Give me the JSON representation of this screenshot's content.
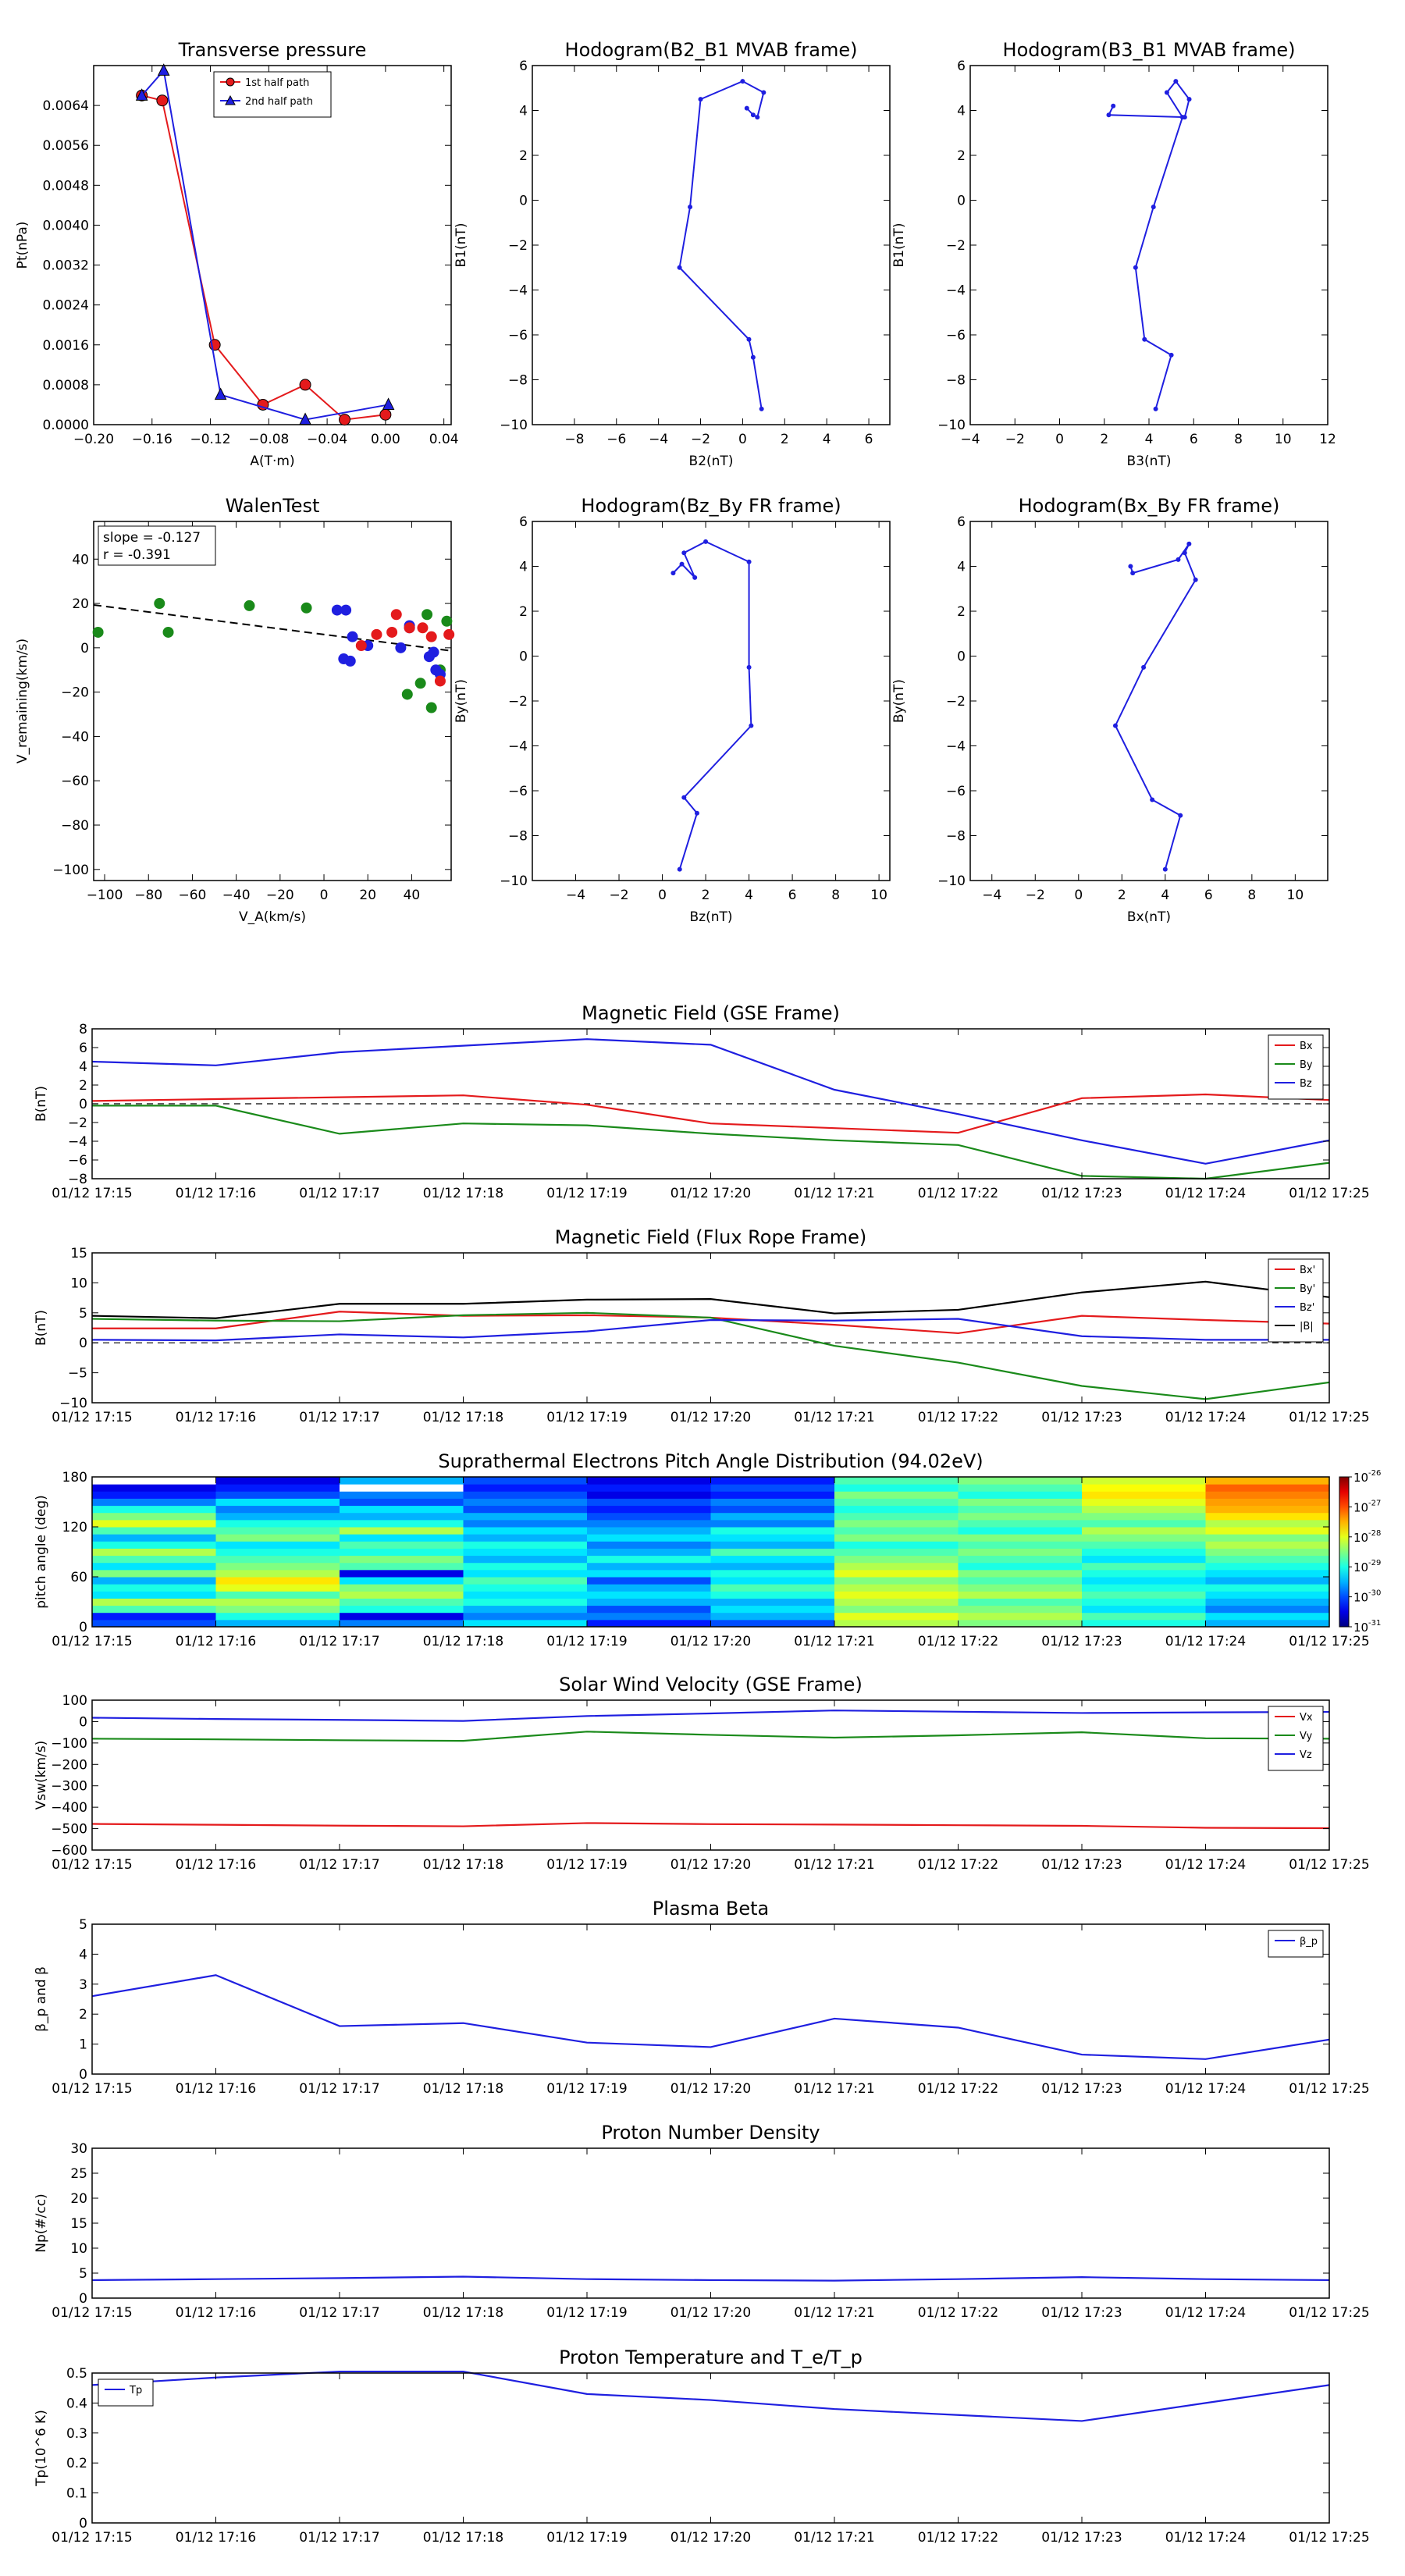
{
  "time_ticks": [
    "01/12 17:15",
    "01/12 17:16",
    "01/12 17:17",
    "01/12 17:18",
    "01/12 17:19",
    "01/12 17:20",
    "01/12 17:21",
    "01/12 17:22",
    "01/12 17:23",
    "01/12 17:24",
    "01/12 17:25"
  ],
  "colors": {
    "red": "#e41a1c",
    "green": "#1a8a1a",
    "blue": "#1f1fe0",
    "black": "#000000"
  },
  "chart_data": [
    {
      "id": "tp",
      "type": "line",
      "title": "Transverse pressure",
      "xlabel": "A(T·m)",
      "ylabel": "Pt(nPa)",
      "xlim": [
        -0.2,
        0.045
      ],
      "ylim": [
        0,
        0.0072
      ],
      "xticks": [
        -0.2,
        -0.16,
        -0.12,
        -0.08,
        -0.04,
        0.0,
        0.04
      ],
      "xtick_labels": [
        "−0.20",
        "−0.16",
        "−0.12",
        "−0.08",
        "−0.04",
        "0.00",
        "0.04"
      ],
      "yticks": [
        0,
        0.0008,
        0.0016,
        0.0024,
        0.0032,
        0.004,
        0.0048,
        0.0056,
        0.0064
      ],
      "ytick_labels": [
        "0.0000",
        "0.0008",
        "0.0016",
        "0.0024",
        "0.0032",
        "0.0040",
        "0.0048",
        "0.0056",
        "0.0064"
      ],
      "legend": {
        "loc": "top-center",
        "entries": [
          "1st half path",
          "2nd half path"
        ]
      },
      "series": [
        {
          "name": "1st half path",
          "color": "red",
          "marker": "circle",
          "x": [
            -0.167,
            -0.153,
            -0.117,
            -0.084,
            -0.055,
            -0.028,
            0.0
          ],
          "y": [
            0.0066,
            0.0065,
            0.0016,
            0.0004,
            0.0008,
            0.0001,
            0.0002
          ]
        },
        {
          "name": "2nd half path",
          "color": "blue",
          "marker": "triangle",
          "x": [
            -0.167,
            -0.152,
            -0.113,
            -0.055,
            0.002
          ],
          "y": [
            0.0066,
            0.0071,
            0.0006,
            0.0001,
            0.0004
          ]
        }
      ]
    },
    {
      "id": "h1",
      "type": "line",
      "title": "Hodogram(B2_B1 MVAB frame)",
      "xlabel": "B2(nT)",
      "ylabel": "B1(nT)",
      "xlim": [
        -10,
        7
      ],
      "ylim": [
        -10,
        6
      ],
      "xticks": [
        -8,
        -6,
        -4,
        -2,
        0,
        2,
        4,
        6
      ],
      "yticks": [
        -10,
        -8,
        -6,
        -4,
        -2,
        0,
        2,
        4,
        6
      ],
      "series": [
        {
          "color": "blue",
          "x": [
            0.9,
            0.5,
            0.3,
            -3.0,
            -2.5,
            -2.0,
            0.0,
            1.0,
            0.7,
            0.5,
            0.2
          ],
          "y": [
            -9.3,
            -7.0,
            -6.2,
            -3.0,
            -0.3,
            4.5,
            5.3,
            4.8,
            3.7,
            3.8,
            4.1
          ]
        }
      ]
    },
    {
      "id": "h2",
      "type": "line",
      "title": "Hodogram(B3_B1 MVAB frame)",
      "xlabel": "B3(nT)",
      "ylabel": "B1(nT)",
      "xlim": [
        -4,
        12
      ],
      "ylim": [
        -10,
        6
      ],
      "xticks": [
        -4,
        -2,
        0,
        2,
        4,
        6,
        8,
        10,
        12
      ],
      "yticks": [
        -10,
        -8,
        -6,
        -4,
        -2,
        0,
        2,
        4,
        6
      ],
      "series": [
        {
          "color": "blue",
          "x": [
            4.3,
            5.0,
            3.8,
            3.4,
            4.2,
            5.5,
            4.8,
            5.2,
            5.8,
            5.6,
            2.2,
            2.4
          ],
          "y": [
            -9.3,
            -6.9,
            -6.2,
            -3.0,
            -0.3,
            3.7,
            4.8,
            5.3,
            4.5,
            3.7,
            3.8,
            4.2
          ]
        }
      ]
    },
    {
      "id": "walen",
      "type": "scatter",
      "title": "WalenTest",
      "xlabel": "V_A(km/s)",
      "ylabel": "V_remaining(km/s)",
      "xlim": [
        -105,
        58
      ],
      "ylim": [
        -105,
        57
      ],
      "xticks": [
        -100,
        -80,
        -60,
        -40,
        -20,
        0,
        20,
        40
      ],
      "yticks": [
        -100,
        -80,
        -60,
        -40,
        -20,
        0,
        20,
        40
      ],
      "annotations": [
        "slope = -0.127",
        "r = -0.391"
      ],
      "fit": {
        "slope": -0.127,
        "intercept": 6
      },
      "series": [
        {
          "color": "green",
          "x": [
            -103,
            -75,
            -71,
            -34,
            -8,
            38,
            44,
            47,
            49,
            56,
            53
          ],
          "y": [
            7,
            20,
            7,
            19,
            18,
            -21,
            -16,
            15,
            -27,
            12,
            -10
          ]
        },
        {
          "color": "blue",
          "x": [
            6,
            10,
            13,
            20,
            35,
            39,
            39,
            48,
            50,
            51,
            53,
            9,
            12
          ],
          "y": [
            17,
            17,
            5,
            1,
            0,
            9,
            10,
            -4,
            -2,
            -10,
            -12,
            -5,
            -6
          ]
        },
        {
          "color": "red",
          "x": [
            17,
            24,
            31,
            33,
            39,
            45,
            49,
            53,
            57
          ],
          "y": [
            1,
            6,
            7,
            15,
            9,
            9,
            5,
            -15,
            6
          ]
        }
      ]
    },
    {
      "id": "h3",
      "type": "line",
      "title": "Hodogram(Bz_By FR frame)",
      "xlabel": "Bz(nT)",
      "ylabel": "By(nT)",
      "xlim": [
        -6,
        10.5
      ],
      "ylim": [
        -10,
        6
      ],
      "xticks": [
        -4,
        -2,
        0,
        2,
        4,
        6,
        8,
        10
      ],
      "yticks": [
        -10,
        -8,
        -6,
        -4,
        -2,
        0,
        2,
        4,
        6
      ],
      "series": [
        {
          "color": "blue",
          "x": [
            0.8,
            1.6,
            1.0,
            4.1,
            4.0,
            4.0,
            2.0,
            1.0,
            1.5,
            0.9,
            0.5
          ],
          "y": [
            -9.5,
            -7.0,
            -6.3,
            -3.1,
            -0.5,
            4.2,
            5.1,
            4.6,
            3.5,
            4.1,
            3.7
          ]
        }
      ]
    },
    {
      "id": "h4",
      "type": "line",
      "title": "Hodogram(Bx_By FR frame)",
      "xlabel": "Bx(nT)",
      "ylabel": "By(nT)",
      "xlim": [
        -5,
        11.5
      ],
      "ylim": [
        -10,
        6
      ],
      "xticks": [
        -4,
        -2,
        0,
        2,
        4,
        6,
        8,
        10
      ],
      "yticks": [
        -10,
        -8,
        -6,
        -4,
        -2,
        0,
        2,
        4,
        6
      ],
      "series": [
        {
          "color": "blue",
          "x": [
            4.0,
            4.7,
            3.4,
            1.7,
            3.0,
            5.4,
            4.9,
            5.1,
            4.6,
            2.5,
            2.4
          ],
          "y": [
            -9.5,
            -7.1,
            -6.4,
            -3.1,
            -0.5,
            3.4,
            4.6,
            5.0,
            4.3,
            3.7,
            4.0
          ]
        }
      ]
    },
    {
      "id": "mag_gse",
      "type": "line",
      "title": "Magnetic Field (GSE Frame)",
      "ylabel": "B(nT)",
      "xticks": "time",
      "ylim": [
        -8,
        8
      ],
      "yticks": [
        -8,
        -6,
        -4,
        -2,
        0,
        2,
        4,
        6,
        8
      ],
      "legend": {
        "loc": "top-right",
        "entries": [
          "Bx",
          "By",
          "Bz"
        ]
      },
      "zero_line": true,
      "x": [
        0,
        1,
        2,
        3,
        4,
        5,
        6,
        7,
        8,
        9,
        10
      ],
      "series": [
        {
          "name": "Bx",
          "color": "red",
          "values": [
            0.3,
            0.5,
            0.7,
            0.9,
            -0.1,
            -2.1,
            -2.6,
            -3.1,
            0.6,
            1.0,
            0.4
          ]
        },
        {
          "name": "By",
          "color": "green",
          "values": [
            -0.2,
            -0.2,
            -3.2,
            -2.1,
            -2.3,
            -3.2,
            -3.9,
            -4.4,
            -7.7,
            -8.0,
            -6.3
          ]
        },
        {
          "name": "Bz",
          "color": "blue",
          "values": [
            4.5,
            4.1,
            5.5,
            6.2,
            6.9,
            6.3,
            1.5,
            -1.1,
            -3.9,
            -6.4,
            -3.9
          ]
        }
      ]
    },
    {
      "id": "mag_fr",
      "type": "line",
      "title": "Magnetic Field (Flux Rope Frame)",
      "ylabel": "B(nT)",
      "xticks": "time",
      "ylim": [
        -10,
        15
      ],
      "yticks": [
        -10,
        -5,
        0,
        5,
        10,
        15
      ],
      "legend": {
        "loc": "top-right",
        "entries": [
          "Bx'",
          "By'",
          "Bz'",
          "|B|"
        ]
      },
      "zero_line": true,
      "x": [
        0,
        1,
        2,
        3,
        4,
        5,
        6,
        7,
        8,
        9,
        10
      ],
      "series": [
        {
          "name": "Bx'",
          "color": "red",
          "values": [
            2.4,
            2.4,
            5.2,
            4.5,
            4.6,
            4.2,
            3.0,
            1.6,
            4.5,
            3.8,
            3.2
          ]
        },
        {
          "name": "By'",
          "color": "green",
          "values": [
            4.0,
            3.7,
            3.6,
            4.6,
            5.0,
            4.2,
            -0.5,
            -3.3,
            -7.2,
            -9.4,
            -6.6
          ]
        },
        {
          "name": "Bz'",
          "color": "blue",
          "values": [
            0.5,
            0.4,
            1.4,
            0.9,
            1.9,
            3.8,
            3.7,
            4.0,
            1.1,
            0.5,
            0.5
          ]
        },
        {
          "name": "|B|",
          "color": "black",
          "values": [
            4.5,
            4.1,
            6.5,
            6.5,
            7.2,
            7.3,
            4.9,
            5.5,
            8.4,
            10.2,
            7.6
          ]
        }
      ]
    },
    {
      "id": "pad",
      "type": "heatmap",
      "title": "Suprathermal Electrons Pitch Angle Distribution (94.02eV)",
      "ylabel": "pitch angle (deg)",
      "xticks": "time",
      "ylim": [
        0,
        180
      ],
      "yticks": [
        0,
        60,
        120,
        180
      ],
      "colorbar": {
        "log_min": -31,
        "log_max": -26,
        "ticks": [
          -31,
          -30,
          -29,
          -28,
          -27,
          -26
        ],
        "tick_labels": [
          "10",
          "10",
          "10",
          "10",
          "10",
          "10"
        ],
        "tick_exponents": [
          "-31",
          "-30",
          "-29",
          "-28",
          "-27",
          "-26"
        ]
      },
      "columns": [
        [
          0.2,
          0.15,
          0.45,
          0.55,
          0.35,
          0.4,
          0.3,
          0.5,
          0.35,
          0.45,
          0.55,
          0.4,
          0.3,
          0.45,
          0.6,
          0.5,
          0.4,
          0.25,
          0.15,
          0.1,
          1.0
        ],
        [
          0.3,
          0.4,
          0.5,
          0.55,
          0.45,
          0.6,
          0.65,
          0.55,
          0.5,
          0.45,
          0.4,
          0.35,
          0.5,
          0.45,
          0.4,
          0.3,
          0.25,
          0.35,
          0.2,
          0.15,
          0.1
        ],
        [
          0.25,
          0.1,
          0.4,
          0.45,
          0.55,
          0.5,
          0.35,
          0.1,
          0.45,
          0.5,
          0.4,
          0.45,
          0.35,
          0.55,
          0.4,
          0.3,
          0.35,
          0.2,
          0.25,
          1.0,
          0.3
        ],
        [
          0.35,
          0.25,
          0.3,
          0.4,
          0.35,
          0.4,
          0.45,
          0.35,
          0.4,
          0.3,
          0.35,
          0.4,
          0.3,
          0.35,
          0.25,
          0.3,
          0.2,
          0.25,
          0.2,
          0.15,
          0.2
        ],
        [
          0.15,
          0.25,
          0.2,
          0.3,
          0.35,
          0.3,
          0.2,
          0.35,
          0.3,
          0.4,
          0.3,
          0.25,
          0.35,
          0.3,
          0.25,
          0.2,
          0.15,
          0.2,
          0.1,
          0.15,
          0.1
        ],
        [
          0.2,
          0.3,
          0.35,
          0.3,
          0.4,
          0.45,
          0.35,
          0.4,
          0.3,
          0.35,
          0.45,
          0.3,
          0.35,
          0.4,
          0.25,
          0.3,
          0.2,
          0.25,
          0.15,
          0.2,
          0.15
        ],
        [
          0.55,
          0.6,
          0.5,
          0.55,
          0.6,
          0.55,
          0.5,
          0.6,
          0.55,
          0.5,
          0.45,
          0.4,
          0.5,
          0.45,
          0.5,
          0.45,
          0.4,
          0.45,
          0.5,
          0.4,
          0.45
        ],
        [
          0.5,
          0.55,
          0.5,
          0.45,
          0.55,
          0.5,
          0.45,
          0.5,
          0.4,
          0.45,
          0.5,
          0.45,
          0.5,
          0.4,
          0.45,
          0.5,
          0.45,
          0.5,
          0.4,
          0.45,
          0.5
        ],
        [
          0.4,
          0.45,
          0.35,
          0.4,
          0.45,
          0.4,
          0.35,
          0.4,
          0.45,
          0.35,
          0.4,
          0.45,
          0.5,
          0.55,
          0.45,
          0.5,
          0.55,
          0.6,
          0.65,
          0.62,
          0.58
        ],
        [
          0.3,
          0.35,
          0.25,
          0.3,
          0.35,
          0.4,
          0.3,
          0.35,
          0.4,
          0.45,
          0.5,
          0.55,
          0.5,
          0.6,
          0.55,
          0.65,
          0.7,
          0.72,
          0.75,
          0.78,
          0.7
        ]
      ]
    },
    {
      "id": "vsw",
      "type": "line",
      "title": "Solar Wind Velocity (GSE Frame)",
      "ylabel": "Vsw(km/s)",
      "xticks": "time",
      "ylim": [
        -600,
        100
      ],
      "yticks": [
        -600,
        -500,
        -400,
        -300,
        -200,
        -100,
        0,
        100
      ],
      "legend": {
        "loc": "top-right",
        "entries": [
          "Vx",
          "Vy",
          "Vz"
        ]
      },
      "x": [
        0,
        1,
        2,
        3,
        4,
        5,
        6,
        7,
        8,
        9,
        10
      ],
      "series": [
        {
          "name": "Vx",
          "color": "red",
          "values": [
            -478,
            -482,
            -486,
            -489,
            -474,
            -479,
            -481,
            -484,
            -487,
            -496,
            -498
          ]
        },
        {
          "name": "Vy",
          "color": "green",
          "values": [
            -80,
            -83,
            -87,
            -90,
            -47,
            -62,
            -75,
            -64,
            -50,
            -78,
            -80
          ]
        },
        {
          "name": "Vz",
          "color": "blue",
          "values": [
            18,
            12,
            8,
            3,
            26,
            38,
            52,
            46,
            40,
            43,
            45
          ]
        }
      ]
    },
    {
      "id": "beta",
      "type": "line",
      "title": "Plasma Beta",
      "ylabel": "β_p and β",
      "xticks": "time",
      "ylim": [
        0,
        5
      ],
      "yticks": [
        0,
        1,
        2,
        3,
        4,
        5
      ],
      "legend": {
        "loc": "top-right",
        "entries": [
          "β_p"
        ]
      },
      "x": [
        0,
        1,
        2,
        3,
        4,
        5,
        6,
        7,
        8,
        9,
        10
      ],
      "series": [
        {
          "name": "β_p",
          "color": "blue",
          "values": [
            2.6,
            3.3,
            1.6,
            1.7,
            1.05,
            0.9,
            1.85,
            1.55,
            0.65,
            0.5,
            1.15
          ]
        }
      ]
    },
    {
      "id": "np",
      "type": "line",
      "title": "Proton Number Density",
      "ylabel": "Np(#/cc)",
      "xticks": "time",
      "ylim": [
        0,
        30
      ],
      "yticks": [
        0,
        5,
        10,
        15,
        20,
        25,
        30
      ],
      "x": [
        0,
        1,
        2,
        3,
        4,
        5,
        6,
        7,
        8,
        9,
        10
      ],
      "series": [
        {
          "color": "blue",
          "values": [
            3.6,
            3.8,
            4.0,
            4.3,
            3.8,
            3.6,
            3.5,
            3.8,
            4.2,
            3.8,
            3.6
          ]
        }
      ]
    },
    {
      "id": "tp_temp",
      "type": "line",
      "title": "Proton Temperature and T_e/T_p",
      "ylabel": "Tp(10^6 K)",
      "xticks": "time",
      "ylim": [
        0,
        0.5
      ],
      "yticks": [
        0,
        0.1,
        0.2,
        0.3,
        0.4,
        0.5
      ],
      "legend": {
        "loc": "top-left",
        "entries": [
          "Tp"
        ]
      },
      "x": [
        0,
        1,
        2,
        3,
        4,
        5,
        6,
        7,
        8,
        9,
        10
      ],
      "series": [
        {
          "name": "Tp",
          "color": "blue",
          "values": [
            0.46,
            0.485,
            0.505,
            0.505,
            0.43,
            0.41,
            0.38,
            0.36,
            0.34,
            0.4,
            0.46
          ]
        }
      ]
    }
  ]
}
